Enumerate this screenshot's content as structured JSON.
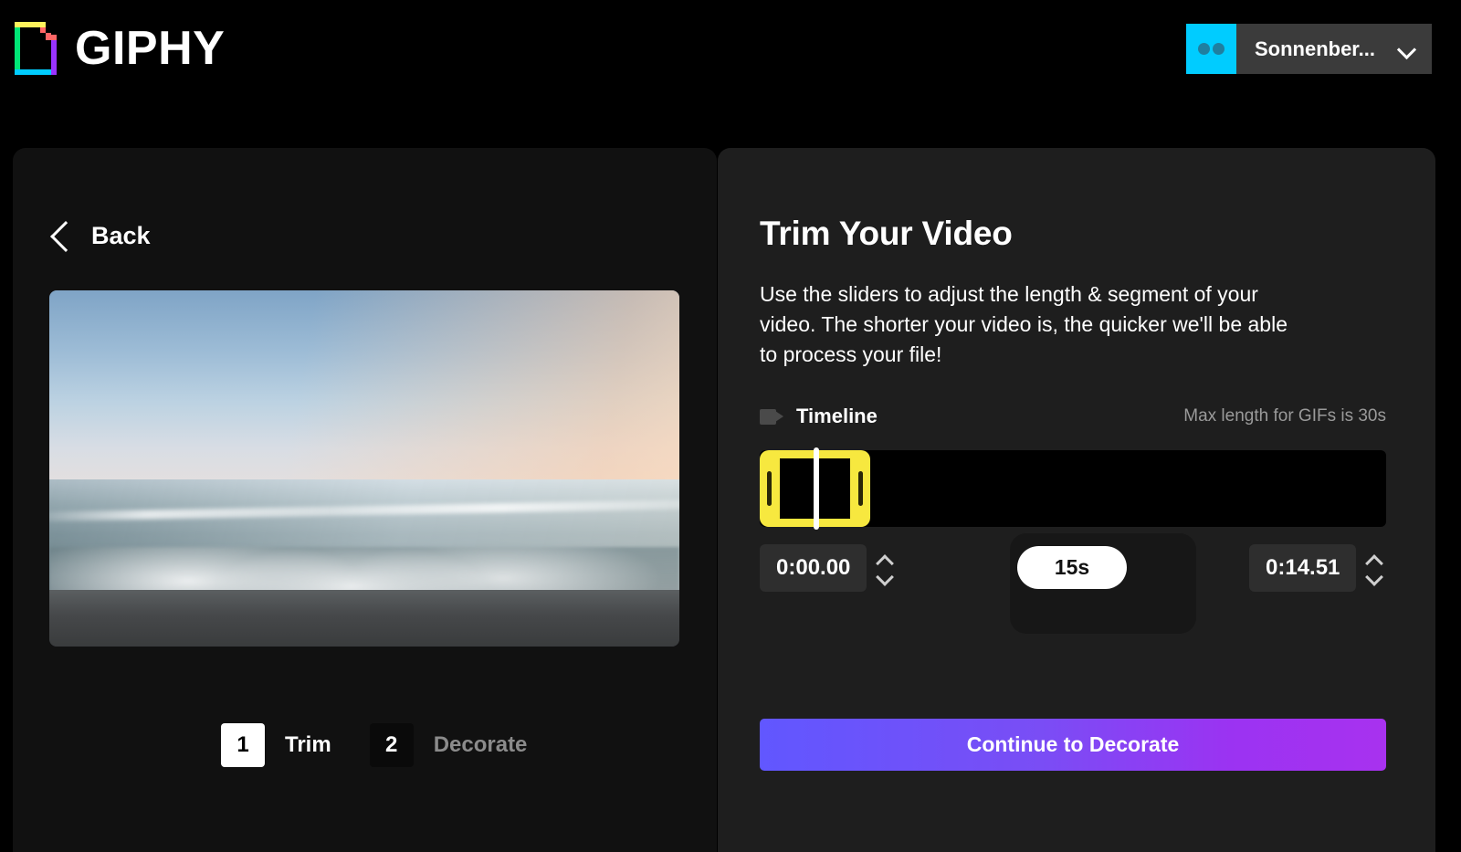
{
  "header": {
    "logo_word": "GIPHY",
    "logo_icon": "giphy-logo-icon",
    "account": {
      "name": "Sonnenber...",
      "avatar_icon": "user-avatar-glasses-icon",
      "caret_icon": "chevron-down-icon",
      "avatar_color": "#00ccff",
      "chip_color": "#3b3b3b"
    }
  },
  "left": {
    "back_label": "Back",
    "back_icon": "chevron-left-icon",
    "preview_alt": "beach sunset ocean waves video preview",
    "steps": [
      {
        "num": "1",
        "label": "Trim",
        "active": true
      },
      {
        "num": "2",
        "label": "Decorate",
        "active": false
      }
    ]
  },
  "right": {
    "title": "Trim Your Video",
    "description": "Use the sliders to adjust the length & segment of your video. The shorter your video is, the quicker we'll be able to process your file!",
    "timeline": {
      "icon": "video-camera-icon",
      "label": "Timeline",
      "note": "Max length for GIFs is 30s",
      "selection_color": "#f7e83f",
      "track_color": "#000000"
    },
    "controls": {
      "start_time": "0:00.00",
      "end_time": "0:14.51",
      "duration": "15s",
      "stepper_up_icon": "chevron-up-icon",
      "stepper_down_icon": "chevron-down-icon"
    },
    "cta_label": "Continue to Decorate",
    "cta_gradient_from": "#6157ff",
    "cta_gradient_to": "#a832ef"
  }
}
